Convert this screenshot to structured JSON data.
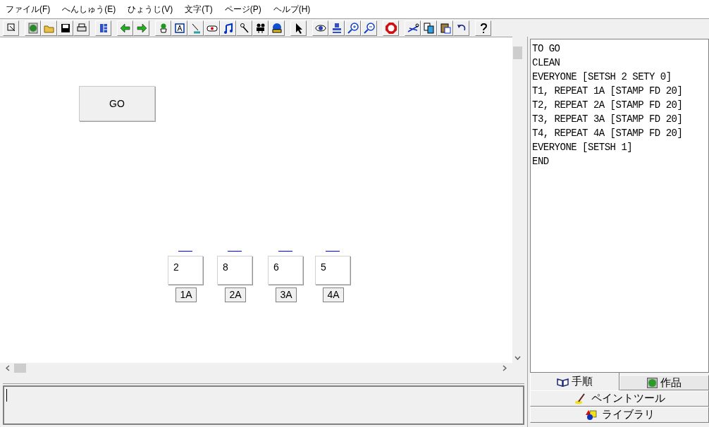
{
  "menu": [
    "ファイル(F)",
    "へんしゅう(E)",
    "ひょうじ(V)",
    "文字(T)",
    "ページ(P)",
    "ヘルプ(H)"
  ],
  "go_button": {
    "label": "GO"
  },
  "boxes": [
    {
      "value": "2",
      "button": "1A"
    },
    {
      "value": "8",
      "button": "2A"
    },
    {
      "value": "6",
      "button": "3A"
    },
    {
      "value": "5",
      "button": "4A"
    }
  ],
  "procedures": [
    "TO GO",
    "CLEAN",
    "EVERYONE [SETSH 2 SETY 0]",
    "T1, REPEAT 1A [STAMP FD 20]",
    "T2, REPEAT 2A [STAMP FD 20]",
    "T3, REPEAT 3A [STAMP FD 20]",
    "T4, REPEAT 4A [STAMP FD 20]",
    "EVERYONE [SETSH 1]",
    "END"
  ],
  "tabs": [
    {
      "label": "手順",
      "selected": true
    },
    {
      "label": "作品",
      "selected": false
    }
  ],
  "panel_buttons": [
    {
      "label": "ペイントツール"
    },
    {
      "label": "ライブラリ"
    }
  ]
}
